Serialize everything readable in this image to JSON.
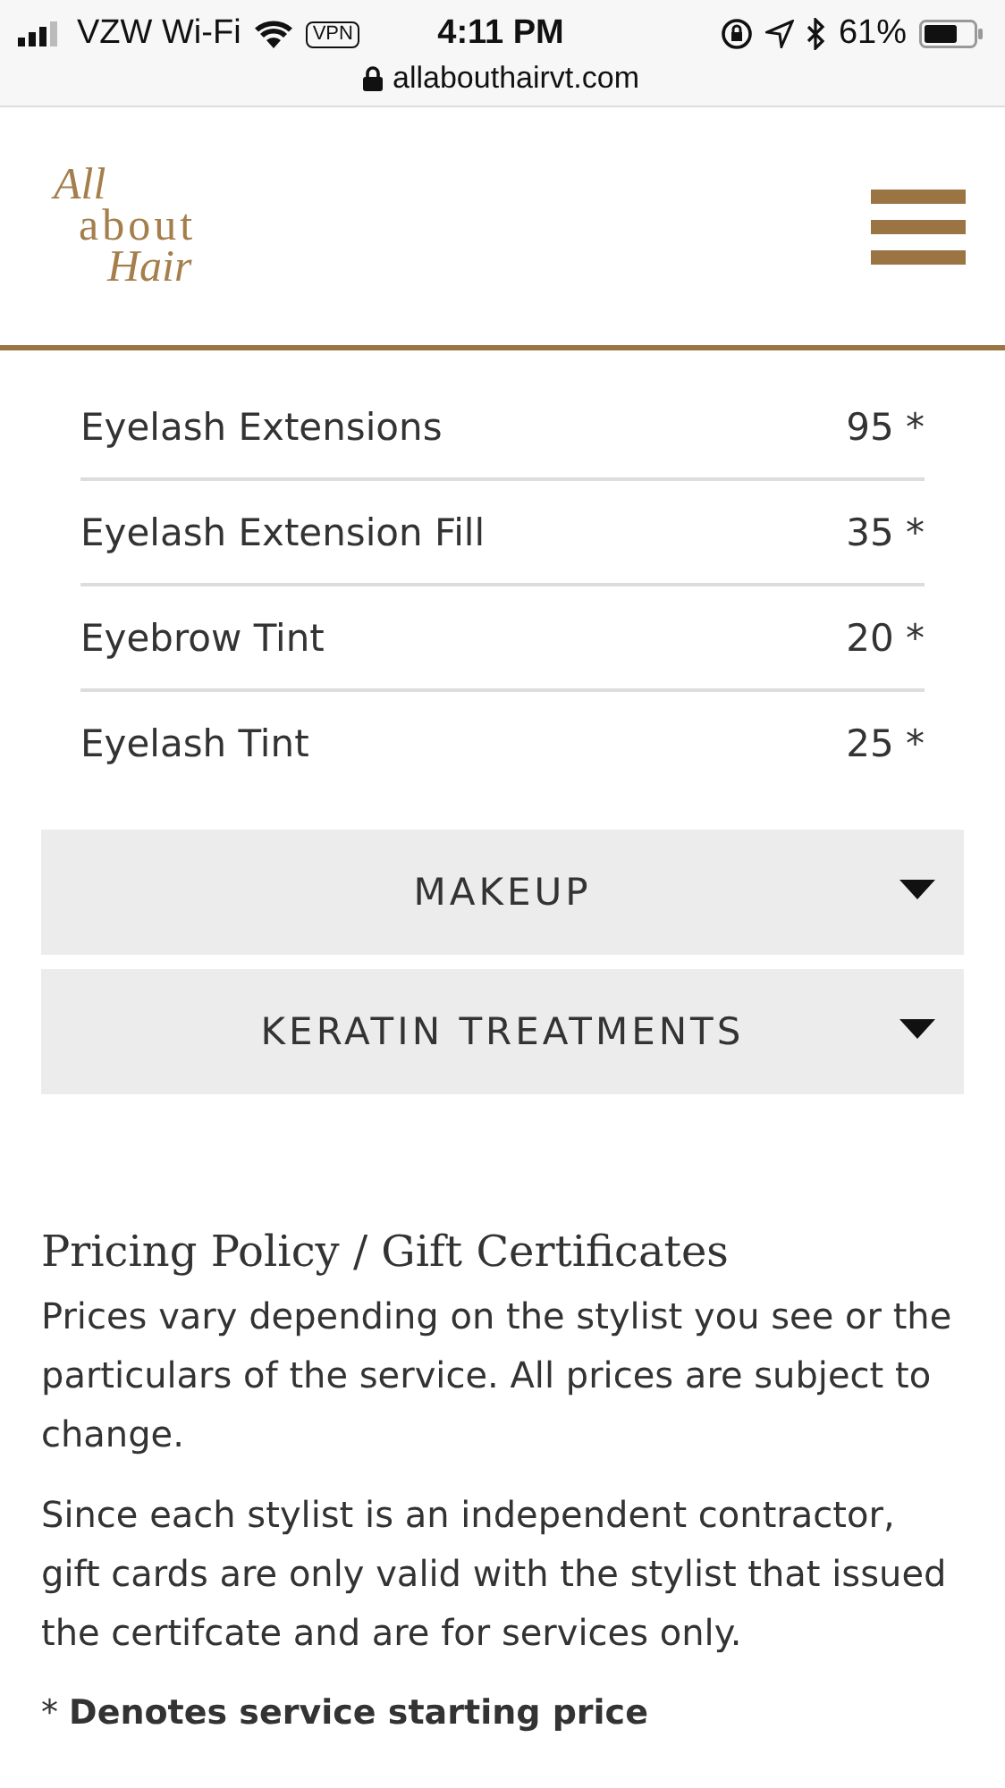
{
  "status_bar": {
    "carrier": "VZW Wi-Fi",
    "vpn": "VPN",
    "time": "4:11 PM",
    "battery_percent": "61%",
    "url": "allabouthairvt.com"
  },
  "header": {
    "logo_lines": [
      "All",
      "about",
      "Hair"
    ]
  },
  "services": [
    {
      "name": "Eyelash Extensions",
      "price": "95 *"
    },
    {
      "name": "Eyelash Extension Fill",
      "price": "35 *"
    },
    {
      "name": "Eyebrow Tint",
      "price": "20 *"
    },
    {
      "name": "Eyelash Tint",
      "price": "25 *"
    }
  ],
  "accordions": [
    {
      "label": "MAKEUP"
    },
    {
      "label": "KERATIN TREATMENTS"
    }
  ],
  "policy": {
    "title": "Pricing Policy / Gift Certificates",
    "paragraphs": [
      "Prices vary depending on the stylist you see or the particulars of the service. All prices are subject to change.",
      "Since each stylist is an independent contractor, gift cards are only valid with the stylist that issued the certifcate and are for services only."
    ],
    "footnote": "* **Denotes service starting price**"
  }
}
